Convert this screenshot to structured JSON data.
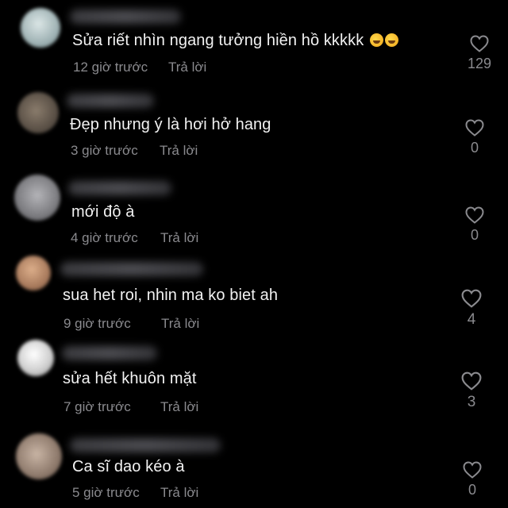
{
  "comments": [
    {
      "text": "Sửa riết nhìn ngang tưởng hiền hồ kkkkk",
      "emoji": [
        "rolling-on-floor-laughing",
        "rolling-on-floor-laughing"
      ],
      "time": "12 giờ trước",
      "reply": "Trả lời",
      "likes": "129",
      "avatar_color": "#b8c8c8"
    },
    {
      "text": "Đẹp nhưng ý là hơi hở hang",
      "time": "3 giờ trước",
      "reply": "Trả lời",
      "likes": "0",
      "avatar_color": "#6e6458"
    },
    {
      "text": "mới độ à",
      "time": "4 giờ trước",
      "reply": "Trả lời",
      "likes": "0",
      "avatar_color": "#9a9a9e"
    },
    {
      "text": "sua het roi, nhin ma ko biet ah",
      "time": "9 giờ trước",
      "reply": "Trả lời",
      "likes": "4",
      "avatar_color": "#b8896a"
    },
    {
      "text": "sửa hết khuôn mặt",
      "time": "7 giờ trước",
      "reply": "Trả lời",
      "likes": "3",
      "avatar_color": "#d8d8d8"
    },
    {
      "text": "Ca sĩ dao kéo à",
      "time": "5 giờ trước",
      "reply": "Trả lời",
      "likes": "0",
      "avatar_color": "#a89484"
    }
  ],
  "icons": {
    "like": "heart-outline-icon"
  },
  "colors": {
    "background": "#000000",
    "text": "#f2f2f2",
    "meta": "#8a8a8e"
  }
}
